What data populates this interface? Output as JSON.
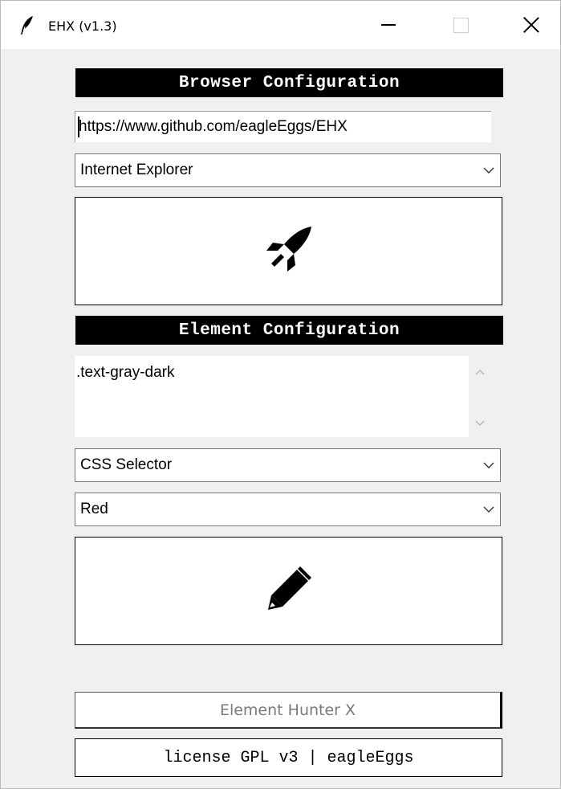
{
  "window": {
    "title": "EHX (v1.3)",
    "icon": "feather-icon",
    "controls": [
      "minimize-icon",
      "maximize-icon",
      "close-icon"
    ]
  },
  "browser_section": {
    "header": "Browser Configuration",
    "url_value": "https://www.github.com/eagleEggs/EHX",
    "browser_select": {
      "selected": "Internet Explorer"
    },
    "launch_button_icon": "rocket-icon"
  },
  "element_section": {
    "header": "Element Configuration",
    "selector_value": ".text-gray-dark",
    "selector_type": {
      "selected": "CSS Selector"
    },
    "highlight_color": {
      "selected": "Red"
    },
    "highlight_button_icon": "pencil-icon"
  },
  "footer": {
    "app_name": "Element Hunter X",
    "license": "license GPL v3 | eagleEggs"
  },
  "colors": {
    "header_bg": "#000000",
    "header_text": "#ffffff",
    "window_bg": "#f0f0f0",
    "footer_app_text": "#7a7a7a"
  }
}
